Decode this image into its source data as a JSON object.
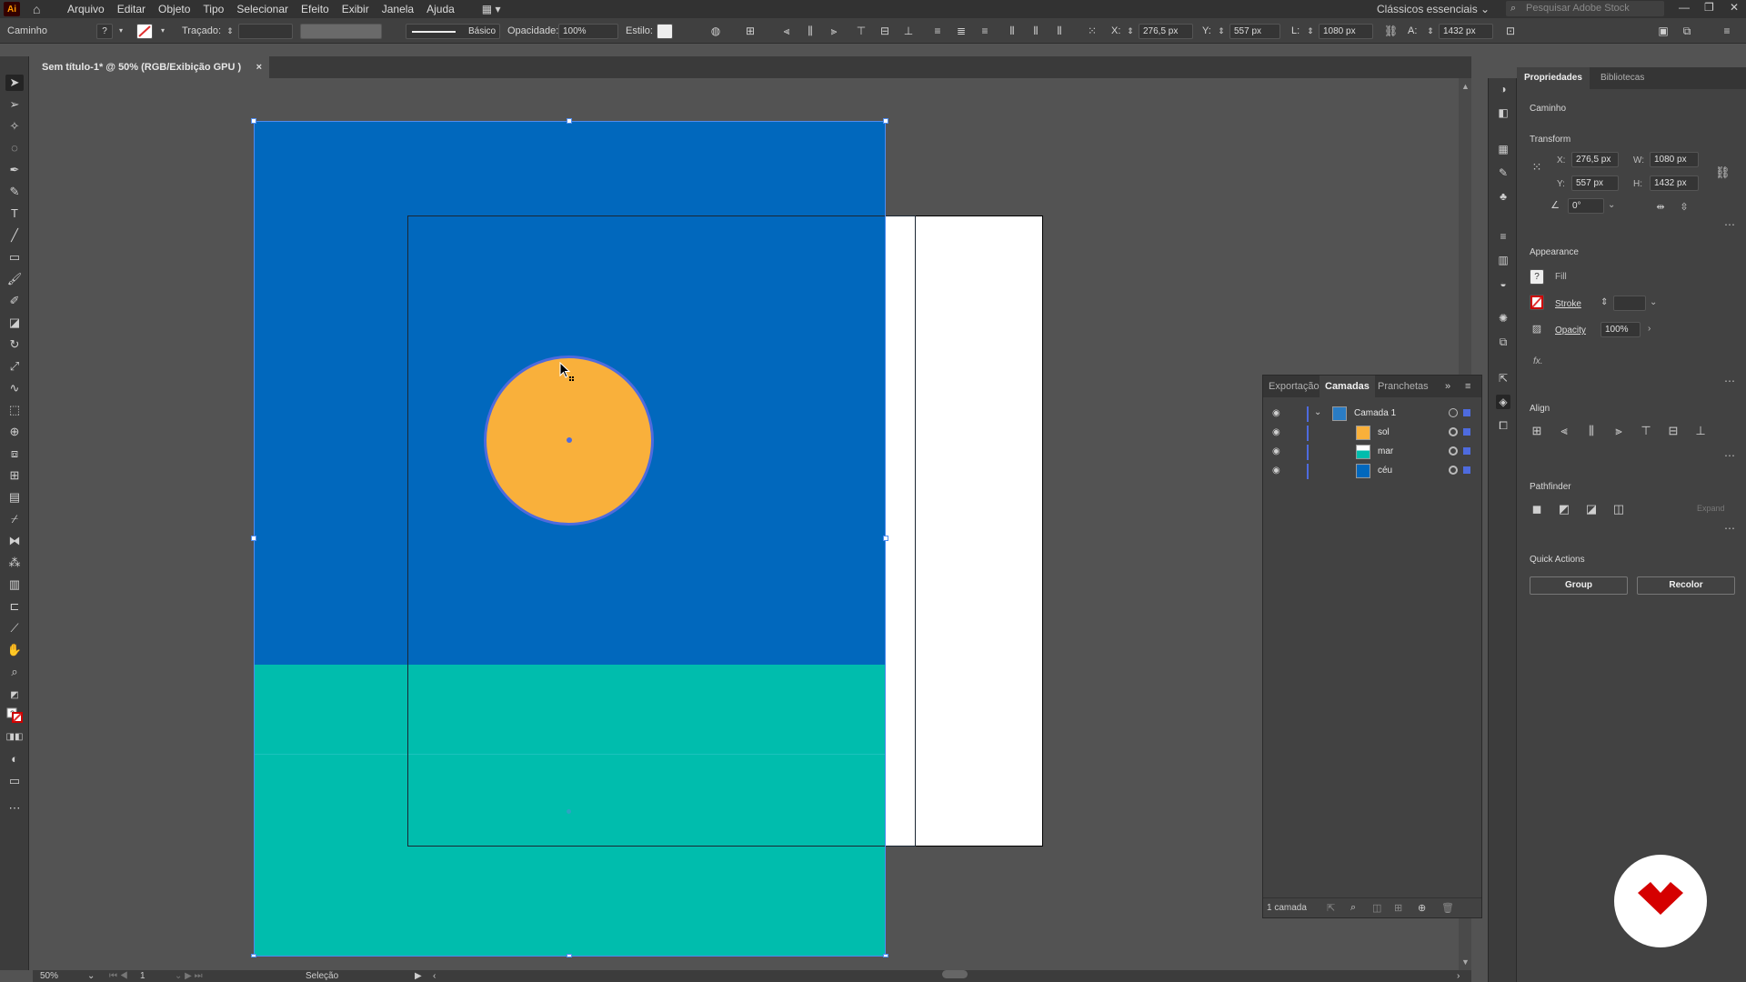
{
  "app": {
    "logo": "Ai",
    "menu": [
      "Arquivo",
      "Editar",
      "Objeto",
      "Tipo",
      "Selecionar",
      "Efeito",
      "Exibir",
      "Janela",
      "Ajuda"
    ],
    "workspace": "Clássicos essenciais",
    "search_placeholder": "Pesquisar Adobe Stock"
  },
  "controlbar": {
    "object_type": "Caminho",
    "fill_value": "?",
    "stroke_label": "Traçado:",
    "brush_label": "Básico",
    "opacity_label": "Opacidade:",
    "opacity_value": "100%",
    "style_label": "Estilo:",
    "x_label": "X:",
    "x_value": "276,5 px",
    "y_label": "Y:",
    "y_value": "557 px",
    "w_label": "L:",
    "w_value": "1080 px",
    "h_label": "A:",
    "h_value": "1432 px"
  },
  "document": {
    "tab_title": "Sem título-1* @ 50% (RGB/Exibição GPU )",
    "close": "×"
  },
  "status": {
    "zoom": "50%",
    "artboard_index": "1",
    "tool_name": "Seleção"
  },
  "layers_panel": {
    "tabs": [
      "Exportação",
      "Camadas",
      "Pranchetas"
    ],
    "layer_name": "Camada 1",
    "sublayers": [
      {
        "name": "sol",
        "color": "#f9b03b"
      },
      {
        "name": "mar",
        "color": "#00bdad"
      },
      {
        "name": "céu",
        "color": "#0168bd"
      }
    ],
    "footer_count": "1 camada"
  },
  "properties": {
    "tabs": [
      "Propriedades",
      "Bibliotecas"
    ],
    "object": "Caminho",
    "transform_title": "Transform",
    "x_label": "X:",
    "x_value": "276,5 px",
    "y_label": "Y:",
    "y_value": "557 px",
    "w_label": "W:",
    "w_value": "1080 px",
    "h_label": "H:",
    "h_value": "1432 px",
    "angle_value": "0°",
    "appearance_title": "Appearance",
    "fill_label": "Fill",
    "fill_value": "?",
    "stroke_label": "Stroke",
    "opacity_label": "Opacity",
    "opacity_value": "100%",
    "fx_label": "fx.",
    "align_title": "Align",
    "pathfinder_title": "Pathfinder",
    "expand_label": "Expand",
    "quick_actions_title": "Quick Actions",
    "group_button": "Group",
    "recolor_button": "Recolor"
  },
  "colors": {
    "sky": "#0168bd",
    "sea": "#00bdad",
    "sun": "#f9b03b",
    "selection": "#4e8cf0",
    "brand_red": "#d50000"
  }
}
